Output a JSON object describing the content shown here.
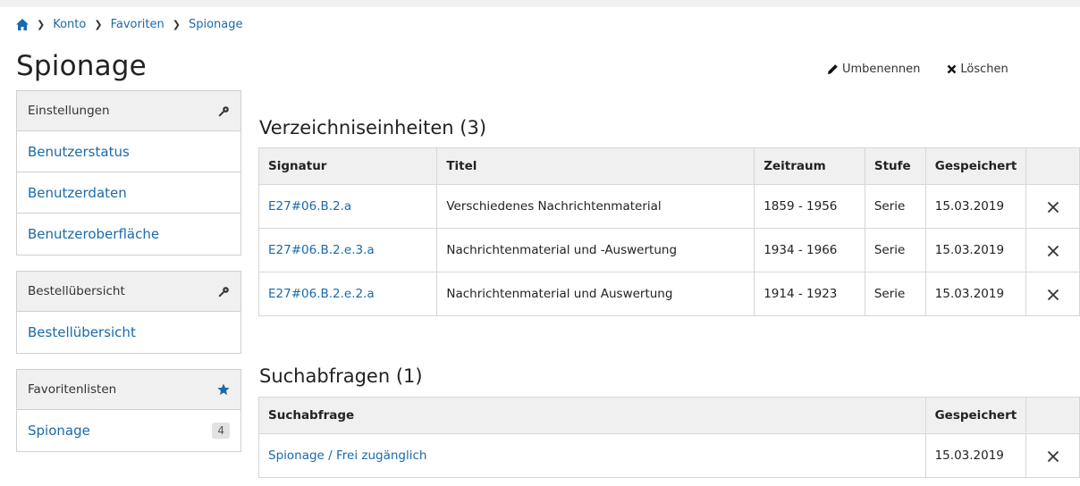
{
  "breadcrumb": {
    "items": [
      "Konto",
      "Favoriten",
      "Spionage"
    ]
  },
  "page": {
    "title": "Spionage"
  },
  "actions": {
    "rename_label": "Umbenennen",
    "delete_label": "Löschen"
  },
  "sidebar": {
    "settings": {
      "heading": "Einstellungen",
      "items": [
        "Benutzerstatus",
        "Benutzerdaten",
        "Benutzeroberfläche"
      ]
    },
    "orders": {
      "heading": "Bestellübersicht",
      "items": [
        "Bestellübersicht"
      ]
    },
    "favorites": {
      "heading": "Favoritenlisten",
      "items": [
        {
          "label": "Spionage",
          "count": "4"
        }
      ]
    }
  },
  "units": {
    "heading": "Verzeichniseinheiten (3)",
    "columns": [
      "Signatur",
      "Titel",
      "Zeitraum",
      "Stufe",
      "Gespeichert"
    ],
    "rows": [
      {
        "signatur": "E27#06.B.2.a",
        "titel": "Verschiedenes Nachrichtenmaterial",
        "zeitraum": "1859 - 1956",
        "stufe": "Serie",
        "gespeichert": "15.03.2019"
      },
      {
        "signatur": "E27#06.B.2.e.3.a",
        "titel": "Nachrichtenmaterial und -Auswertung",
        "zeitraum": "1934 - 1966",
        "stufe": "Serie",
        "gespeichert": "15.03.2019"
      },
      {
        "signatur": "E27#06.B.2.e.2.a",
        "titel": "Nachrichtenmaterial und Auswertung",
        "zeitraum": "1914 - 1923",
        "stufe": "Serie",
        "gespeichert": "15.03.2019"
      }
    ]
  },
  "queries": {
    "heading": "Suchabfragen (1)",
    "columns": [
      "Suchabfrage",
      "Gespeichert"
    ],
    "rows": [
      {
        "suchabfrage": "Spionage / Frei zugänglich",
        "gespeichert": "15.03.2019"
      }
    ]
  },
  "colors": {
    "link": "#1a6aa8",
    "favorite_star": "#1a6aa8",
    "header_bg": "#f0f0f0"
  },
  "icons": {
    "home": "home-icon",
    "chevron": "chevron-right-icon",
    "pencil": "pencil-icon",
    "delete": "close-icon",
    "settings_key": "key-icon",
    "star": "star-icon"
  }
}
